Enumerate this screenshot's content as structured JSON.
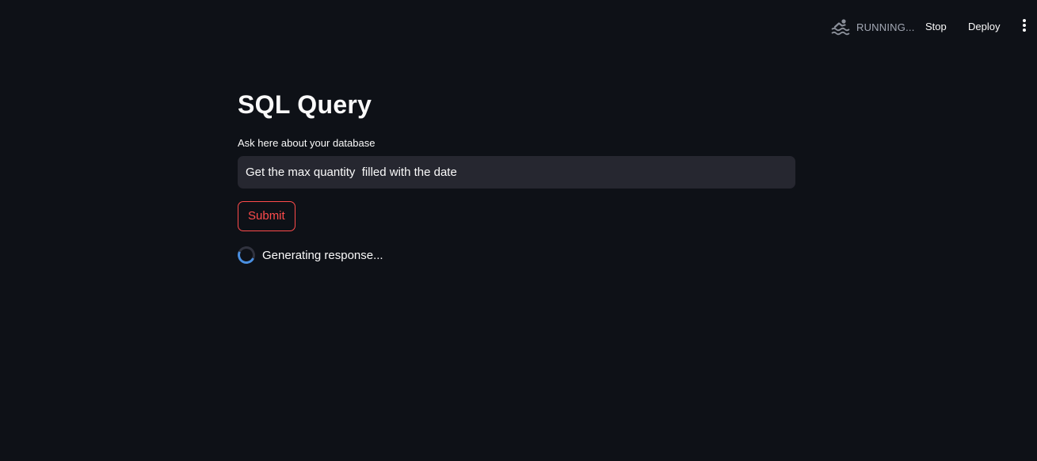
{
  "header": {
    "status": "RUNNING...",
    "status_icon": "swimmer-icon",
    "stop_label": "Stop",
    "deploy_label": "Deploy",
    "menu_icon": "kebab-menu-icon"
  },
  "main": {
    "title": "SQL Query",
    "input_label": "Ask here about your database",
    "input_value": "Get the max quantity  filled with the date",
    "submit_label": "Submit",
    "spinner_text": "Generating response..."
  },
  "colors": {
    "background": "#0e1117",
    "input_background": "#262730",
    "accent": "#ff4b4b",
    "spinner": "#4a8fe0"
  }
}
